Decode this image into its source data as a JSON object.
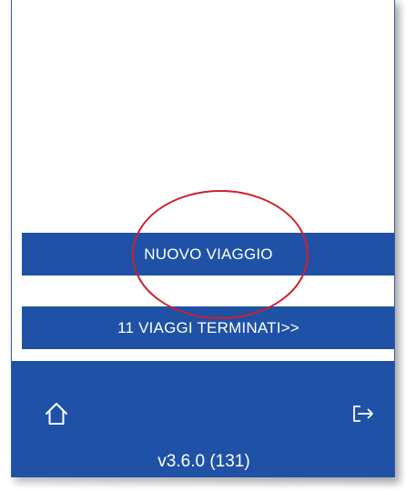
{
  "buttons": {
    "new_trip": "NUOVO VIAGGIO",
    "completed_trips": "11 VIAGGI TERMINATI>>"
  },
  "footer": {
    "version": "v3.6.0 (131)",
    "home_icon": "home-icon",
    "logout_icon": "logout-icon"
  },
  "colors": {
    "primary": "#1f52a6",
    "annotation": "#d0202a"
  }
}
